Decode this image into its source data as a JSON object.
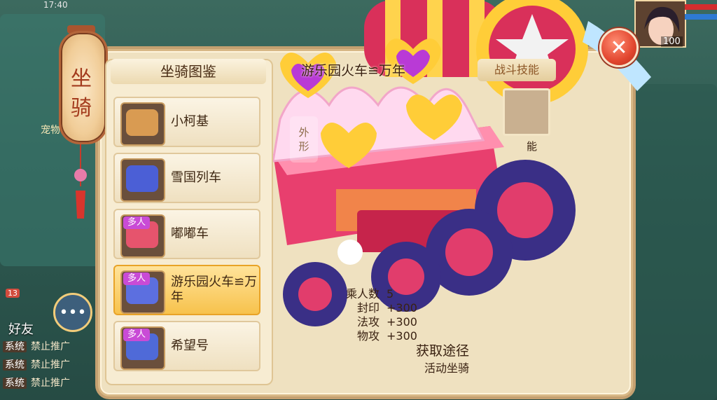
{
  "status": {
    "time": "17:40"
  },
  "lantern": {
    "title": "坐骑"
  },
  "list": {
    "title": "坐骑图鉴",
    "items": [
      {
        "name": "小柯基",
        "badge": "",
        "thumb_color": "#d99b52",
        "selected": false
      },
      {
        "name": "雪国列车",
        "badge": "",
        "thumb_color": "#4b5fd6",
        "selected": false
      },
      {
        "name": "嘟嘟车",
        "badge": "多人",
        "thumb_color": "#e6546d",
        "selected": false
      },
      {
        "name": "游乐园火车≌万年",
        "badge": "多人",
        "thumb_color": "#5c6fe0",
        "selected": true
      },
      {
        "name": "希望号",
        "badge": "多人",
        "thumb_color": "#4f6ad8",
        "selected": false
      }
    ]
  },
  "detail": {
    "title": "游乐园火车≌万年",
    "appearance_tag": [
      "外",
      "形"
    ],
    "skill_button": "战斗技能",
    "skill_caption": "能",
    "stats": [
      {
        "label": "乘人数",
        "value": "5"
      },
      {
        "label": "封印",
        "value": "+300"
      },
      {
        "label": "法攻",
        "value": "+300"
      },
      {
        "label": "物攻",
        "value": "+300"
      }
    ],
    "acquire_title": "获取途径",
    "acquire_value": "活动坐骑"
  },
  "close": {
    "icon": "close-icon"
  },
  "player": {
    "level": "100"
  },
  "chat": {
    "friends_label": "好友",
    "friends_count": "13",
    "system_lines": [
      {
        "tag": "系统",
        "text": "禁止推广"
      },
      {
        "tag": "系统",
        "text": "禁止推广"
      },
      {
        "tag": "系统",
        "text": "禁止推广"
      }
    ]
  },
  "pet_label": "宠物"
}
